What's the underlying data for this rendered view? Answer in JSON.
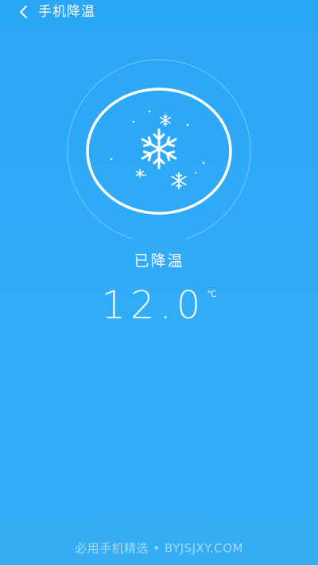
{
  "header": {
    "back_icon": "chevron-left-icon",
    "title": "手机降温"
  },
  "cooling": {
    "icon": "snowflake-icon",
    "status": "已降温",
    "temperature": "12.0",
    "unit": "℃"
  },
  "watermark": {
    "text": "必用手机精选 • BYJSJXY.COM"
  },
  "colors": {
    "background": "#2ea9f6",
    "foreground": "#ffffff"
  }
}
